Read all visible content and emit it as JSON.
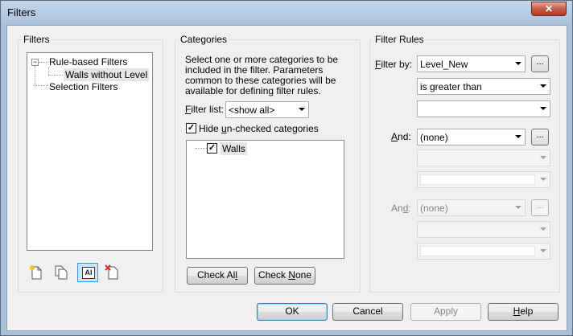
{
  "window": {
    "title": "Filters",
    "close_label": "✕"
  },
  "filters_panel": {
    "label": "Filters",
    "tree": {
      "root": {
        "label": "Rule-based Filters",
        "expander": "−"
      },
      "child": {
        "label": "Walls without Level"
      },
      "sibling": {
        "label": "Selection Filters"
      }
    },
    "icons": [
      "new-filter-icon",
      "duplicate-icon",
      "rename-icon",
      "delete-icon"
    ],
    "rename_glyph": "AI"
  },
  "categories_panel": {
    "label": "Categories",
    "description": [
      "Select one or more categories to be",
      "included in the filter.  Parameters",
      "common to these categories will be",
      "available for defining filter rules."
    ],
    "filter_list_label_pre": "",
    "filter_list_label_u": "F",
    "filter_list_label_post": "ilter list:",
    "filter_list_value": "<show all>",
    "hide_label_pre": "Hide ",
    "hide_label_u": "u",
    "hide_label_post": "n-checked categories",
    "hide_checked": true,
    "items": [
      {
        "label": "Walls",
        "checked": true
      }
    ],
    "check_all_pre": "Check Al",
    "check_all_u": "l",
    "check_none_pre": "Check ",
    "check_none_u": "N",
    "check_none_post": "one"
  },
  "rules_panel": {
    "label": "Filter Rules",
    "filter_by_u": "F",
    "filter_by_post": "ilter by:",
    "filter_by_value": "Level_New",
    "operator_value": "is greater than",
    "value_1": "",
    "and1_u": "A",
    "and1_post": "nd:",
    "and1_value": "(none)",
    "and2_pre": "An",
    "and2_u": "d",
    "and2_post": ":",
    "and2_value": "(none)",
    "ellipsis": "..."
  },
  "footer": {
    "ok": "OK",
    "cancel": "Cancel",
    "apply": "Apply",
    "help_u": "H",
    "help_post": "elp"
  }
}
